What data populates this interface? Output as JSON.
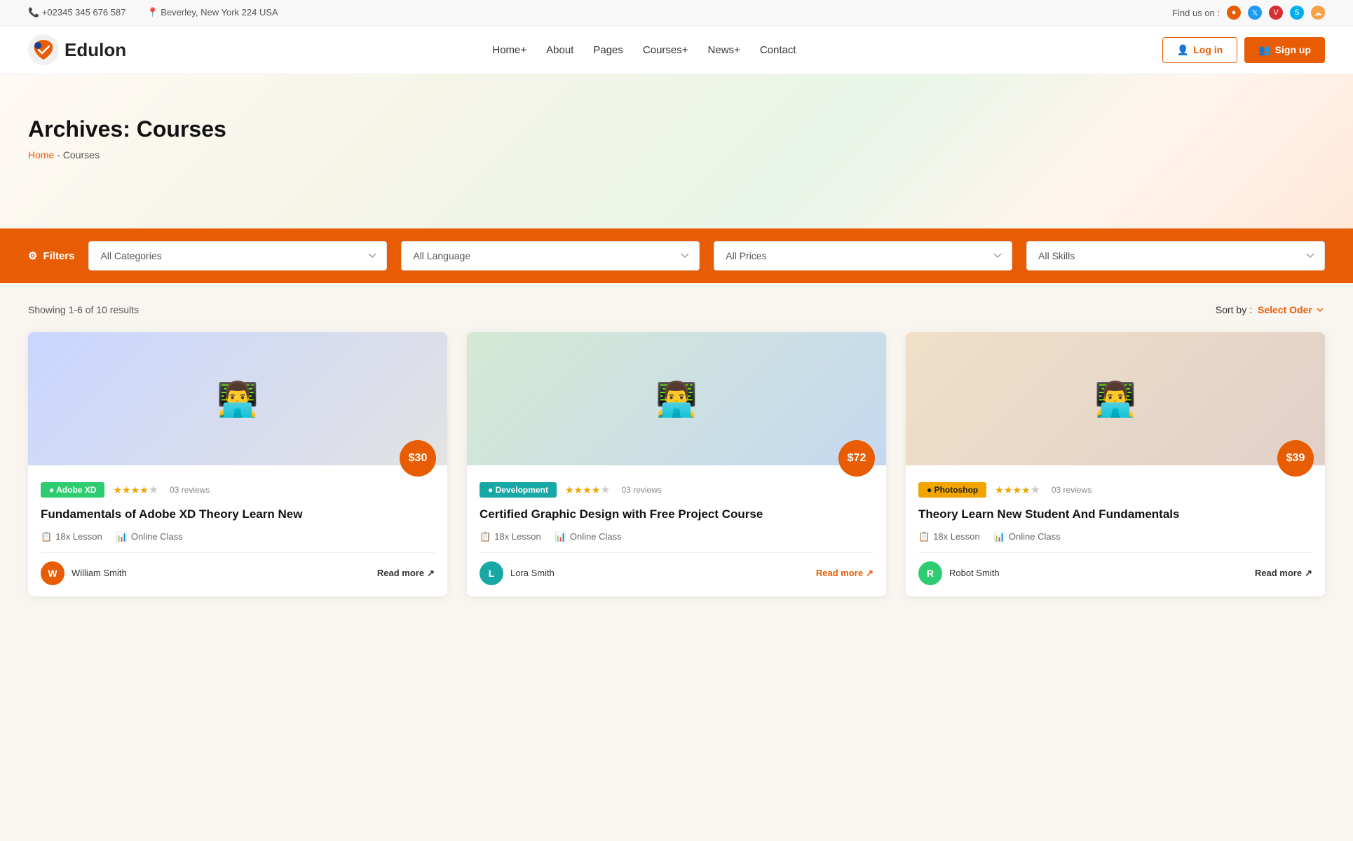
{
  "topbar": {
    "phone": "+02345 345 676 587",
    "address": "Beverley, New York 224 USA",
    "findus": "Find us on :"
  },
  "navbar": {
    "logo_text": "Edulon",
    "links": [
      {
        "label": "Home+",
        "id": "home"
      },
      {
        "label": "About",
        "id": "about"
      },
      {
        "label": "Pages",
        "id": "pages"
      },
      {
        "label": "Courses+",
        "id": "courses"
      },
      {
        "label": "News+",
        "id": "news"
      },
      {
        "label": "Contact",
        "id": "contact"
      }
    ],
    "login_label": "Log in",
    "signup_label": "Sign up"
  },
  "hero": {
    "title": "Archives: Courses",
    "breadcrumb_home": "Home",
    "breadcrumb_sep": " - ",
    "breadcrumb_current": "Courses"
  },
  "filters": {
    "label": "Filters",
    "categories_placeholder": "All Categories",
    "language_placeholder": "All Language",
    "prices_placeholder": "All Prices",
    "skills_placeholder": "All Skills"
  },
  "results": {
    "showing_text": "Showing 1-6 of 10 results",
    "sort_label": "Sort by :",
    "sort_value": "Select Oder"
  },
  "courses": [
    {
      "tag": "Adobe XD",
      "tag_class": "tag-green",
      "stars": 3.5,
      "reviews": "03 reviews",
      "price": "$30",
      "title": "Fundamentals of Adobe XD Theory Learn New",
      "lessons": "18x Lesson",
      "class_type": "Online Class",
      "instructor": "William Smith",
      "read_more": "Read more",
      "img_class": "img1"
    },
    {
      "tag": "Development",
      "tag_class": "tag-teal",
      "stars": 3.5,
      "reviews": "03 reviews",
      "price": "$72",
      "title": "Certified Graphic Design with Free Project Course",
      "lessons": "18x Lesson",
      "class_type": "Online Class",
      "instructor": "Lora Smith",
      "read_more": "Read more",
      "img_class": "img2"
    },
    {
      "tag": "Photoshop",
      "tag_class": "tag-yellow",
      "stars": 3.5,
      "reviews": "03 reviews",
      "price": "$39",
      "title": "Theory Learn New Student And Fundamentals",
      "lessons": "18x Lesson",
      "class_type": "Online Class",
      "instructor": "Robot Smith",
      "read_more": "Read more",
      "img_class": "img3"
    }
  ]
}
